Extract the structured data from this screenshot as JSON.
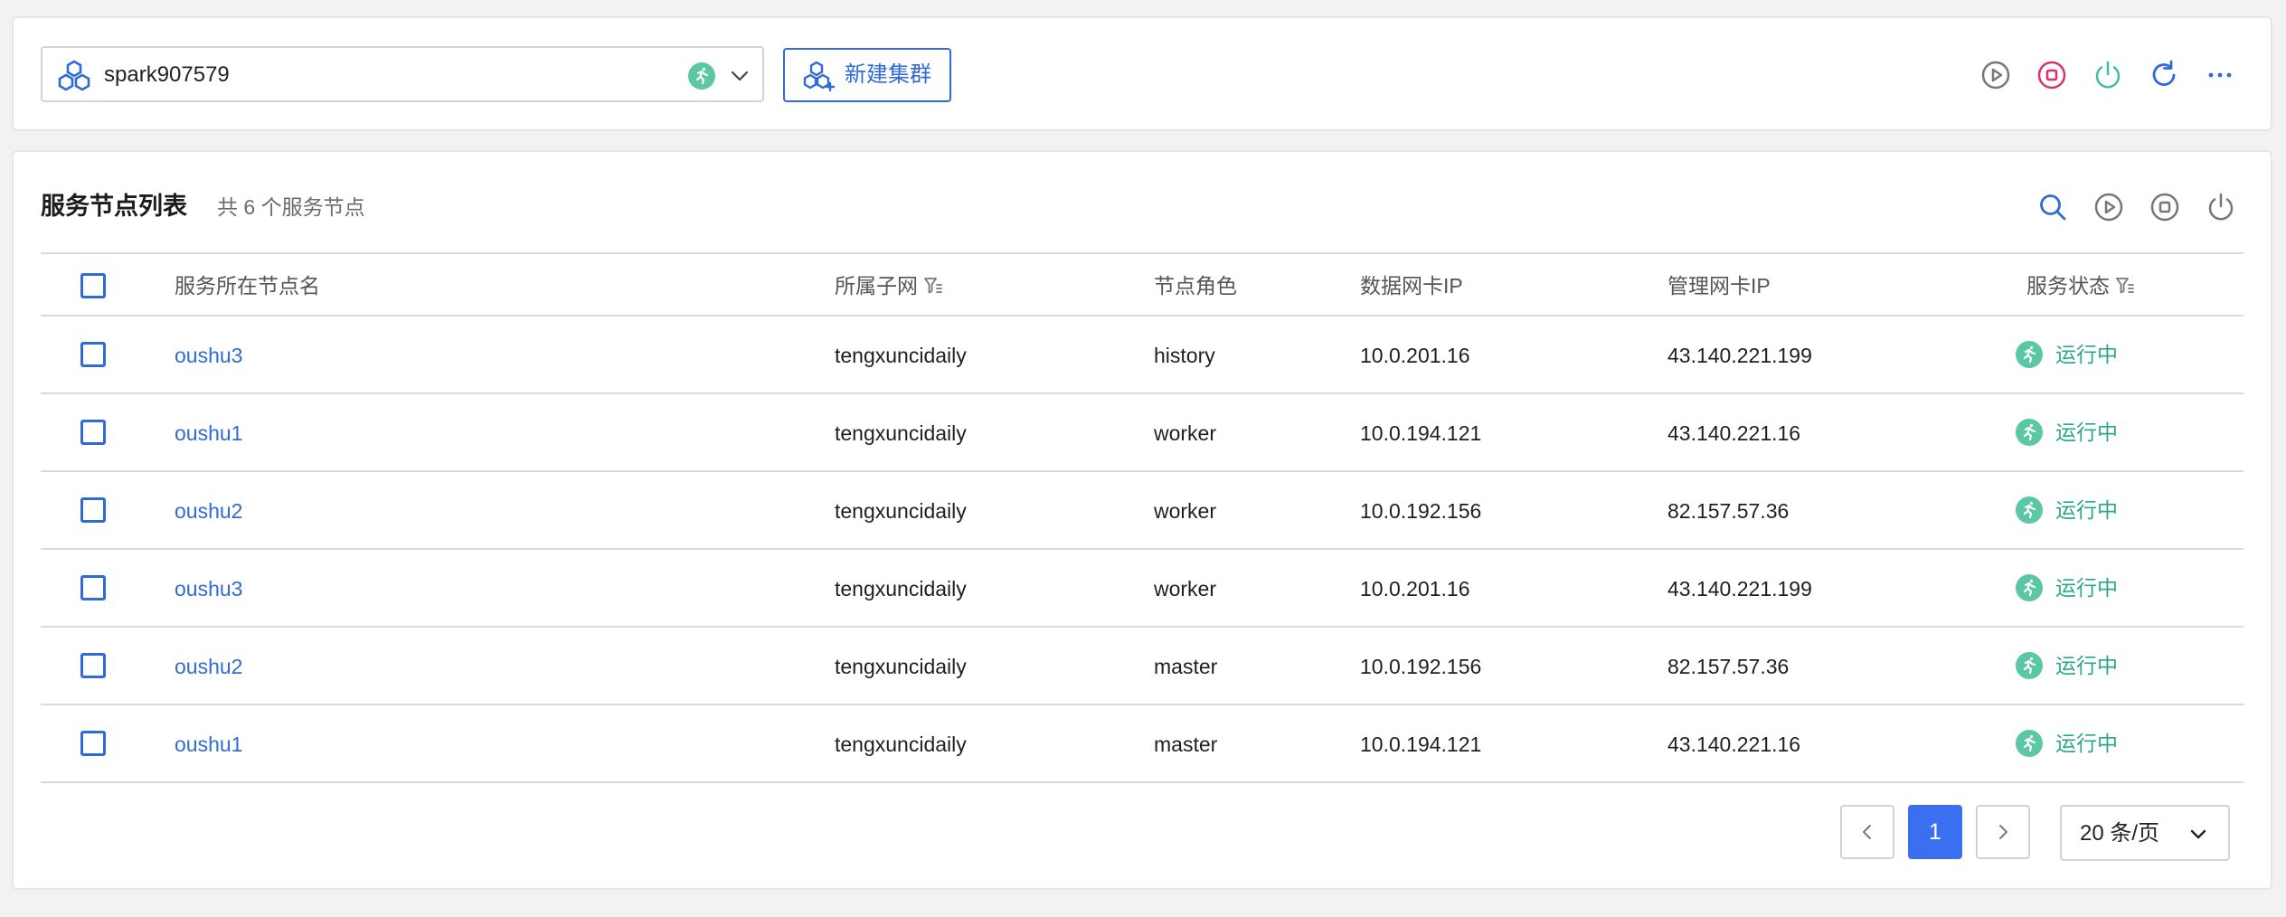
{
  "header": {
    "cluster_name": "spark907579",
    "new_cluster_label": "新建集群"
  },
  "section": {
    "title": "服务节点列表",
    "count_text": "共 6 个服务节点"
  },
  "table": {
    "columns": [
      "服务所在节点名",
      "所属子网",
      "节点角色",
      "数据网卡IP",
      "管理网卡IP",
      "服务状态"
    ],
    "rows": [
      {
        "node": "oushu3",
        "subnet": "tengxuncidaily",
        "role": "history",
        "data_ip": "10.0.201.16",
        "mgmt_ip": "43.140.221.199",
        "status": "运行中"
      },
      {
        "node": "oushu1",
        "subnet": "tengxuncidaily",
        "role": "worker",
        "data_ip": "10.0.194.121",
        "mgmt_ip": "43.140.221.16",
        "status": "运行中"
      },
      {
        "node": "oushu2",
        "subnet": "tengxuncidaily",
        "role": "worker",
        "data_ip": "10.0.192.156",
        "mgmt_ip": "82.157.57.36",
        "status": "运行中"
      },
      {
        "node": "oushu3",
        "subnet": "tengxuncidaily",
        "role": "worker",
        "data_ip": "10.0.201.16",
        "mgmt_ip": "43.140.221.199",
        "status": "运行中"
      },
      {
        "node": "oushu2",
        "subnet": "tengxuncidaily",
        "role": "master",
        "data_ip": "10.0.192.156",
        "mgmt_ip": "82.157.57.36",
        "status": "运行中"
      },
      {
        "node": "oushu1",
        "subnet": "tengxuncidaily",
        "role": "master",
        "data_ip": "10.0.194.121",
        "mgmt_ip": "43.140.221.16",
        "status": "运行中"
      }
    ]
  },
  "pagination": {
    "current_page": "1",
    "page_size_label": "20 条/页"
  },
  "colors": {
    "accent": "#2f6ad8",
    "primary_button": "#3a6ff0",
    "running": "#2aa889",
    "stop": "#d9336b",
    "power": "#3fbf9f",
    "gray_icon": "#777777"
  },
  "icons": {
    "cluster": "cluster-icon",
    "status_running": "running-man-icon",
    "top_actions": [
      "play-icon",
      "stop-icon",
      "power-icon",
      "refresh-icon",
      "more-icon"
    ],
    "section_actions": [
      "search-icon",
      "play-icon",
      "stop-icon",
      "power-icon"
    ]
  }
}
